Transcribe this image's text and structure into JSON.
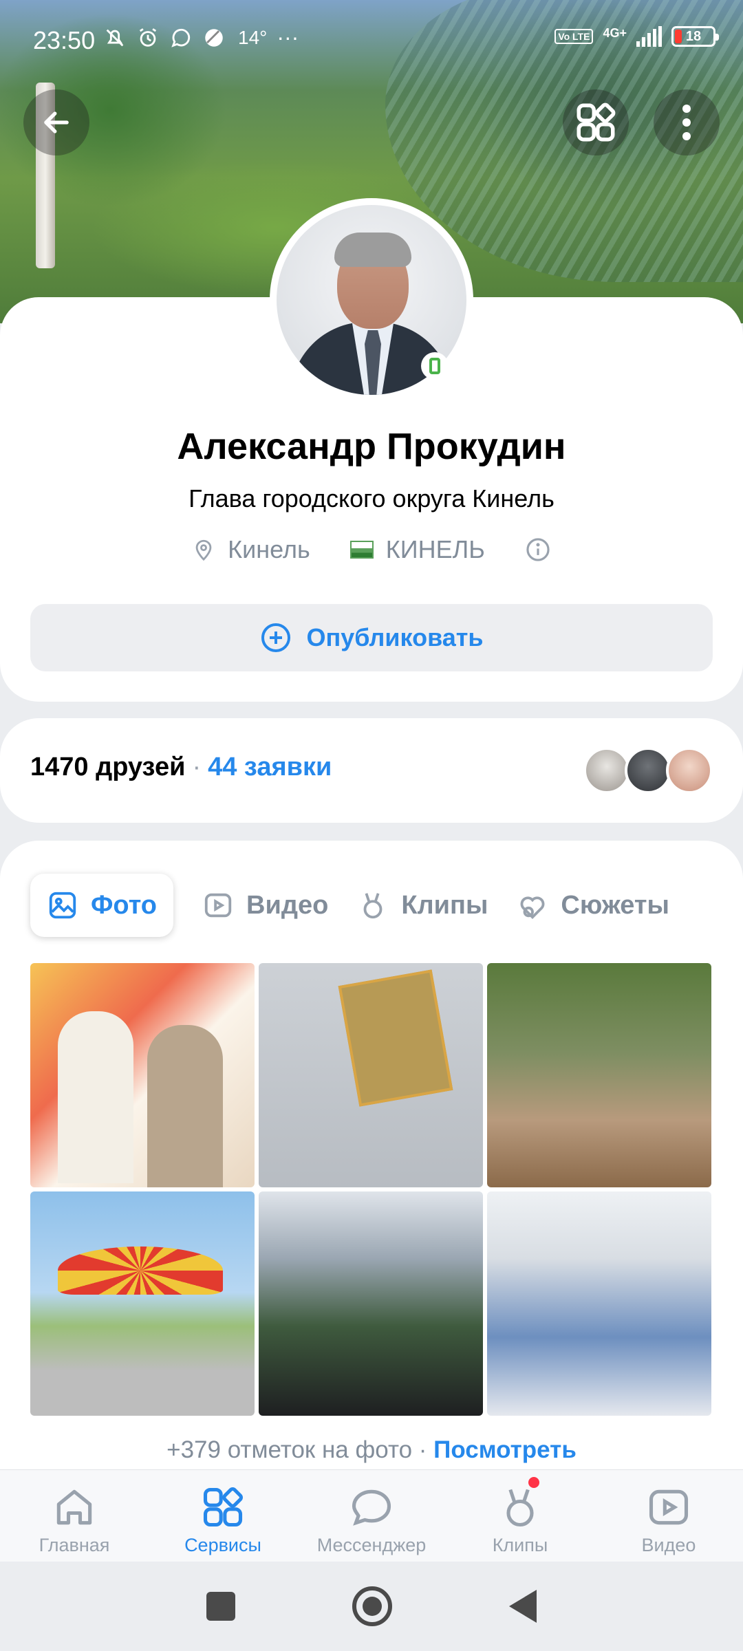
{
  "status_bar": {
    "time": "23:50",
    "temperature": "14°",
    "more": "···",
    "battery_level": "18",
    "network": "4G+",
    "volte": "Vo LTE"
  },
  "profile": {
    "name": "Александр Прокудин",
    "status": "Глава городского округа Кинель",
    "city": "Кинель",
    "community": "КИНЕЛЬ",
    "publish_label": "Опубликовать"
  },
  "friends": {
    "count_label": "1470 друзей",
    "separator": "·",
    "requests_label": "44 заявки",
    "avatar_colors": [
      "#c9c4bf",
      "#4a4d52",
      "#d9b7a6"
    ]
  },
  "media": {
    "tabs": [
      {
        "label": "Фото",
        "icon": "image-icon"
      },
      {
        "label": "Видео",
        "icon": "video-icon"
      },
      {
        "label": "Клипы",
        "icon": "clips-icon"
      },
      {
        "label": "Сюжеты",
        "icon": "stories-icon"
      }
    ],
    "photo_tags_text": "+379 отметок на фото · ",
    "photo_tags_link": "Посмотреть"
  },
  "bottom_nav": [
    {
      "label": "Главная",
      "icon": "home-icon"
    },
    {
      "label": "Сервисы",
      "icon": "services-icon"
    },
    {
      "label": "Мессенджер",
      "icon": "messenger-icon"
    },
    {
      "label": "Клипы",
      "icon": "clips-icon"
    },
    {
      "label": "Видео",
      "icon": "video-icon"
    }
  ],
  "colors": {
    "accent": "#2688eb",
    "secondary_text": "#818c99",
    "badge_red": "#ff3347",
    "online_green": "#4bb34b"
  }
}
